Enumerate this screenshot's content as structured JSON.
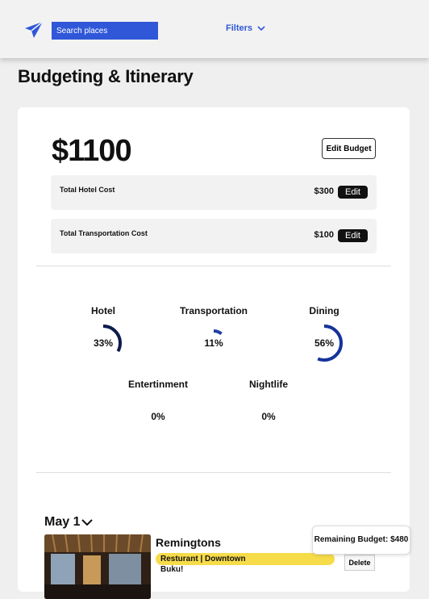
{
  "header": {
    "logo_icon": "paper-plane-icon",
    "search_placeholder": "Search places",
    "filters_label": "Filters",
    "brand_color": "#2f57d8"
  },
  "page": {
    "title": "Budgeting & Itinerary"
  },
  "budget": {
    "amount": "$1100",
    "edit_label": "Edit Budget",
    "costs": [
      {
        "label": "Total Hotel Cost",
        "value": "$300",
        "edit_label": "Edit"
      },
      {
        "label": "Total Transportation Cost",
        "value": "$100",
        "edit_label": "Edit"
      }
    ]
  },
  "breakdown": [
    {
      "label": "Hotel",
      "percent_text": "33%",
      "fraction": 0.33,
      "color": "#0d1b4d"
    },
    {
      "label": "Transportation",
      "percent_text": "11%",
      "fraction": 0.11,
      "color": "#1f3fa3"
    },
    {
      "label": "Dining",
      "percent_text": "56%",
      "fraction": 0.56,
      "color": "#16339a"
    },
    {
      "label": "Entertinment",
      "percent_text": "0%",
      "fraction": 0,
      "color": "#16339a"
    },
    {
      "label": "Nightlife",
      "percent_text": "0%",
      "fraction": 0,
      "color": "#16339a"
    }
  ],
  "itinerary": {
    "day_label": "May 1",
    "items": [
      {
        "name": "Remingtons",
        "tag": "Resturant | Downtown",
        "extra": "Buku!",
        "delete_label": "Delete"
      }
    ]
  },
  "remaining": {
    "label": "Remaining Budget: $480"
  }
}
